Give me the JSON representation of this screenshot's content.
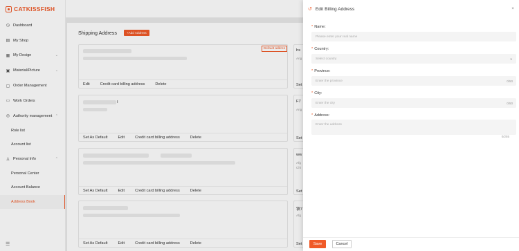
{
  "brand": {
    "name": "CATKISSFISH"
  },
  "sidebar": {
    "items": [
      {
        "label": "Dashboard",
        "icon": "dashboard-icon"
      },
      {
        "label": "My Shop",
        "icon": "shop-icon"
      },
      {
        "label": "My Design",
        "icon": "design-icon"
      },
      {
        "label": "Material/Picture",
        "icon": "picture-icon"
      },
      {
        "label": "Order Management",
        "icon": "order-icon"
      },
      {
        "label": "Work Orders",
        "icon": "work-order-icon"
      },
      {
        "label": "Authority management",
        "icon": "authority-icon"
      },
      {
        "label": "Role list"
      },
      {
        "label": "Account list"
      },
      {
        "label": "Personal Info",
        "icon": "person-icon"
      },
      {
        "label": "Personal Center"
      },
      {
        "label": "Account Balance"
      },
      {
        "label": "Address Book"
      }
    ]
  },
  "main": {
    "title": "Shipping Address",
    "add_button": "+Add Address",
    "default_tag": "Default addres",
    "actions": {
      "set_default": "Set As Default",
      "edit": "Edit",
      "credit": "Credit card billing address",
      "delete": "Delete"
    },
    "right_cards": [
      {
        "title": "hs",
        "sub": "Ang"
      },
      {
        "title": "F7",
        "sub": "Ang"
      },
      {
        "title": "ww",
        "sub": "Afg",
        "sub2": "Chi"
      },
      {
        "title": "Set"
      },
      {
        "title": "铁7",
        "sub": "Afg"
      },
      {
        "title": "Set"
      }
    ],
    "card2_text": "I"
  },
  "drawer": {
    "title": "Edit Billing Address",
    "fields": {
      "name": {
        "label": "Name:",
        "placeholder": "Please enter your real name"
      },
      "country": {
        "label": "Country:",
        "placeholder": "Select country"
      },
      "province": {
        "label": "Province:",
        "placeholder": "Enter the province",
        "count": "0/50"
      },
      "city": {
        "label": "City:",
        "placeholder": "Enter the city",
        "count": "0/50"
      },
      "address": {
        "label": "Address:",
        "placeholder": "Enter the address",
        "count": "0/255"
      }
    },
    "save": "Save",
    "cancel": "Cancel"
  },
  "colors": {
    "accent": "#f05a28"
  }
}
